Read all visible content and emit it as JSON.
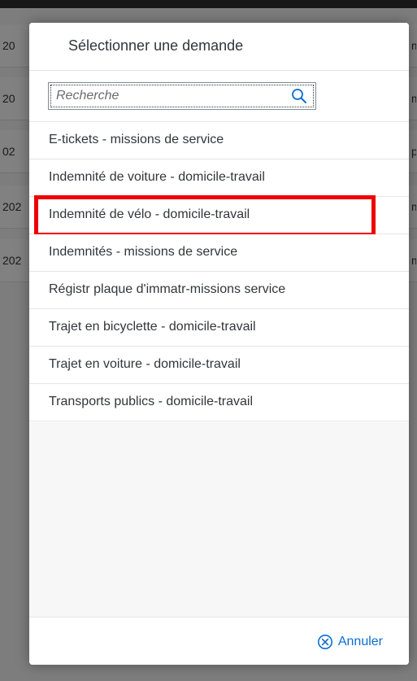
{
  "background": {
    "rows": [
      {
        "left": "20",
        "right": "m"
      },
      {
        "left": "20",
        "right": "m"
      },
      {
        "left": "02",
        "right": "p"
      },
      {
        "left": "202",
        "right": "m"
      },
      {
        "left": "202",
        "right": "m"
      }
    ]
  },
  "dialog": {
    "title": "Sélectionner une demande",
    "search": {
      "placeholder": "Recherche",
      "value": "",
      "icon": "search-icon"
    },
    "items": [
      {
        "label": "E-tickets - missions de service",
        "highlighted": false
      },
      {
        "label": "Indemnité de voiture - domicile-travail",
        "highlighted": false
      },
      {
        "label": "Indemnité de vélo - domicile-travail",
        "highlighted": true
      },
      {
        "label": "Indemnités - missions de service",
        "highlighted": false
      },
      {
        "label": "Régistr plaque d'immatr-missions service",
        "highlighted": false
      },
      {
        "label": "Trajet en bicyclette - domicile-travail",
        "highlighted": false
      },
      {
        "label": "Trajet en voiture - domicile-travail",
        "highlighted": false
      },
      {
        "label": "Transports publics - domicile-travail",
        "highlighted": false
      }
    ],
    "footer": {
      "cancel_label": "Annuler",
      "cancel_icon": "close-circle-icon"
    }
  },
  "colors": {
    "accent": "#0a6ed1",
    "highlight": "#ee0000",
    "text": "#32363a"
  }
}
